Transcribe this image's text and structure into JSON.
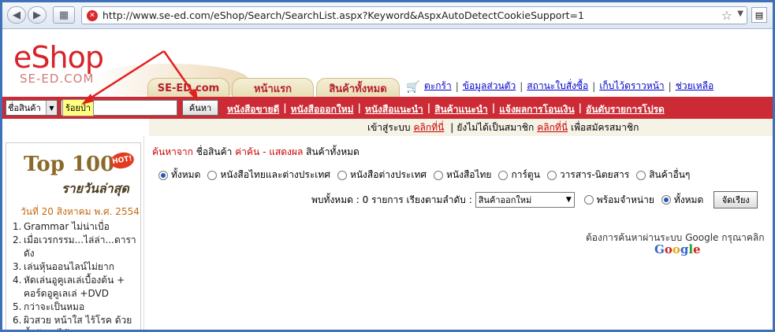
{
  "browser": {
    "url": "http://www.se-ed.com/eShop/Search/SearchList.aspx?Keyword&AspxAutoDetectCookieSupport=1",
    "security_icon": "blocked-site-icon"
  },
  "logo": {
    "main": "eShop",
    "sub": "SE-ED.COM"
  },
  "tabs": [
    {
      "label": "SE-ED.com"
    },
    {
      "label": "หน้าแรก"
    },
    {
      "label": "สินค้าทั้งหมด"
    }
  ],
  "toplinks": [
    "ตะกร้า",
    "ข้อมูลส่วนตัว",
    "สถานะใบสั่งซื้อ",
    "เก็บไว้ดราวหน้า",
    "ช่วยเหลือ"
  ],
  "search": {
    "select_value": "ชื่อสินค้า",
    "tooltip": "ร้อยป่า",
    "button": "ค้นหา"
  },
  "redlinks": [
    "หนังสือขายดี",
    "หนังสือออกใหม่",
    "หนังสือแนะนำ",
    "สินค้าแนะนำ",
    "แจ้งผลการโอนเงิน",
    "อันดับรายการโปรด"
  ],
  "login": {
    "text1": "เข้าสู่ระบบ",
    "link1": "คลิกที่นี่",
    "text2": "ยังไม่ได้เป็นสมาชิก",
    "link2": "คลิกที่นี่",
    "text3": "เพื่อสมัครสมาชิก"
  },
  "top100": {
    "title": "Top 100",
    "hot": "HOT!",
    "daily": "รายวันล่าสุด",
    "date": "วันที่ 20 สิงหาคม พ.ศ. 2554",
    "items": [
      {
        "n": "1.",
        "t": "Grammar ไม่น่าเบื่อ"
      },
      {
        "n": "2.",
        "t": "เมื่อเวรกรรม...ไล่ล่า...ดาราดัง"
      },
      {
        "n": "3.",
        "t": "เล่นหุ้นออนไลน์ไม่ยาก"
      },
      {
        "n": "4.",
        "t": "หัดเล่นอูคูเลเล่เบื้องต้น + คอร์ดอูคูเลเล่ +DVD"
      },
      {
        "n": "5.",
        "t": "กว่าจะเป็นหมอ"
      },
      {
        "n": "6.",
        "t": "ผิวสวย หน้าใส ไร้โรค ด้วยน้ำผักผลไม้"
      }
    ]
  },
  "crumb": {
    "a": "ค้นหาจาก",
    "b": "ชื่อสินค้า",
    "c": "ค่าค้น",
    "d": "- แสดงผล",
    "e": "สินค้าทั้งหมด"
  },
  "categories": [
    "ทั้งหมด",
    "หนังสือไทยและต่างประเทศ",
    "หนังสือต่างประเทศ",
    "หนังสือไทย",
    "การ์ตูน",
    "วารสาร-นิตยสาร",
    "สินค้าอื่นๆ"
  ],
  "results": {
    "text": "พบทั้งหมด : 0 รายการ เรียงตามลำดับ :",
    "sort": "สินค้าออกใหม่",
    "opt1": "พร้อมจำหน่าย",
    "opt2": "ทั้งหมด",
    "button": "จัดเรียง"
  },
  "google": {
    "text": "ต้องการค้นหาผ่านระบบ Google กรุณาคลิก",
    "logo": "Google"
  }
}
